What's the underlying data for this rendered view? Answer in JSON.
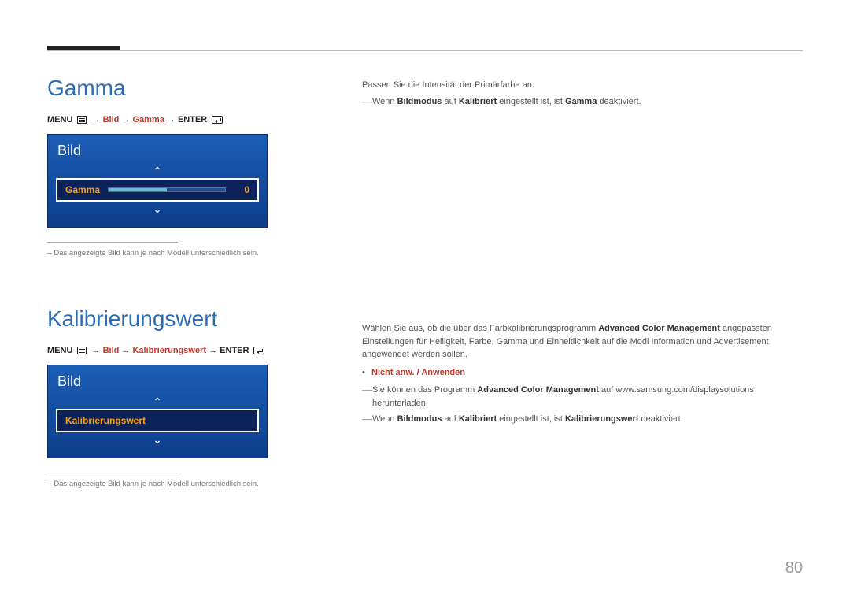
{
  "page_number": "80",
  "gamma": {
    "title": "Gamma",
    "nav": {
      "menu_label": "MENU",
      "arrow": "→",
      "bild": "Bild",
      "item": "Gamma",
      "enter": "ENTER"
    },
    "osd": {
      "panel_title": "Bild",
      "row_label": "Gamma",
      "row_value": "0"
    },
    "footnote": "Das angezeigte Bild kann je nach Modell unterschiedlich sein.",
    "desc_main": "Passen Sie die Intensität der Primärfarbe an.",
    "desc_note_prefix": "Wenn ",
    "desc_note_bold1": "Bildmodus",
    "desc_note_mid1": " auf ",
    "desc_note_bold2": "Kalibriert",
    "desc_note_mid2": " eingestellt ist, ist ",
    "desc_note_bold3": "Gamma",
    "desc_note_suffix": " deaktiviert."
  },
  "kalib": {
    "title": "Kalibrierungswert",
    "nav": {
      "menu_label": "MENU",
      "arrow": "→",
      "bild": "Bild",
      "item": "Kalibrierungswert",
      "enter": "ENTER"
    },
    "osd": {
      "panel_title": "Bild",
      "row_label": "Kalibrierungswert"
    },
    "footnote": "Das angezeigte Bild kann je nach Modell unterschiedlich sein.",
    "desc_line1_a": "Wählen Sie aus, ob die über das Farbkalibrierungsprogramm ",
    "desc_line1_b": "Advanced Color Management",
    "desc_line1_c": " angepassten Einstellungen für Helligkeit, Farbe, Gamma und Einheitlichkeit auf die Modi Information und Advertisement angewendet werden sollen.",
    "bullet_text": "Nicht anw. / Anwenden",
    "note1_a": "Sie können das Programm ",
    "note1_b": "Advanced Color Management",
    "note1_c": " auf www.samsung.com/displaysolutions herunterladen.",
    "note2_a": "Wenn ",
    "note2_b1": "Bildmodus",
    "note2_mid1": " auf ",
    "note2_b2": "Kalibriert",
    "note2_mid2": " eingestellt ist, ist ",
    "note2_b3": "Kalibrierungswert",
    "note2_suffix": " deaktiviert."
  }
}
